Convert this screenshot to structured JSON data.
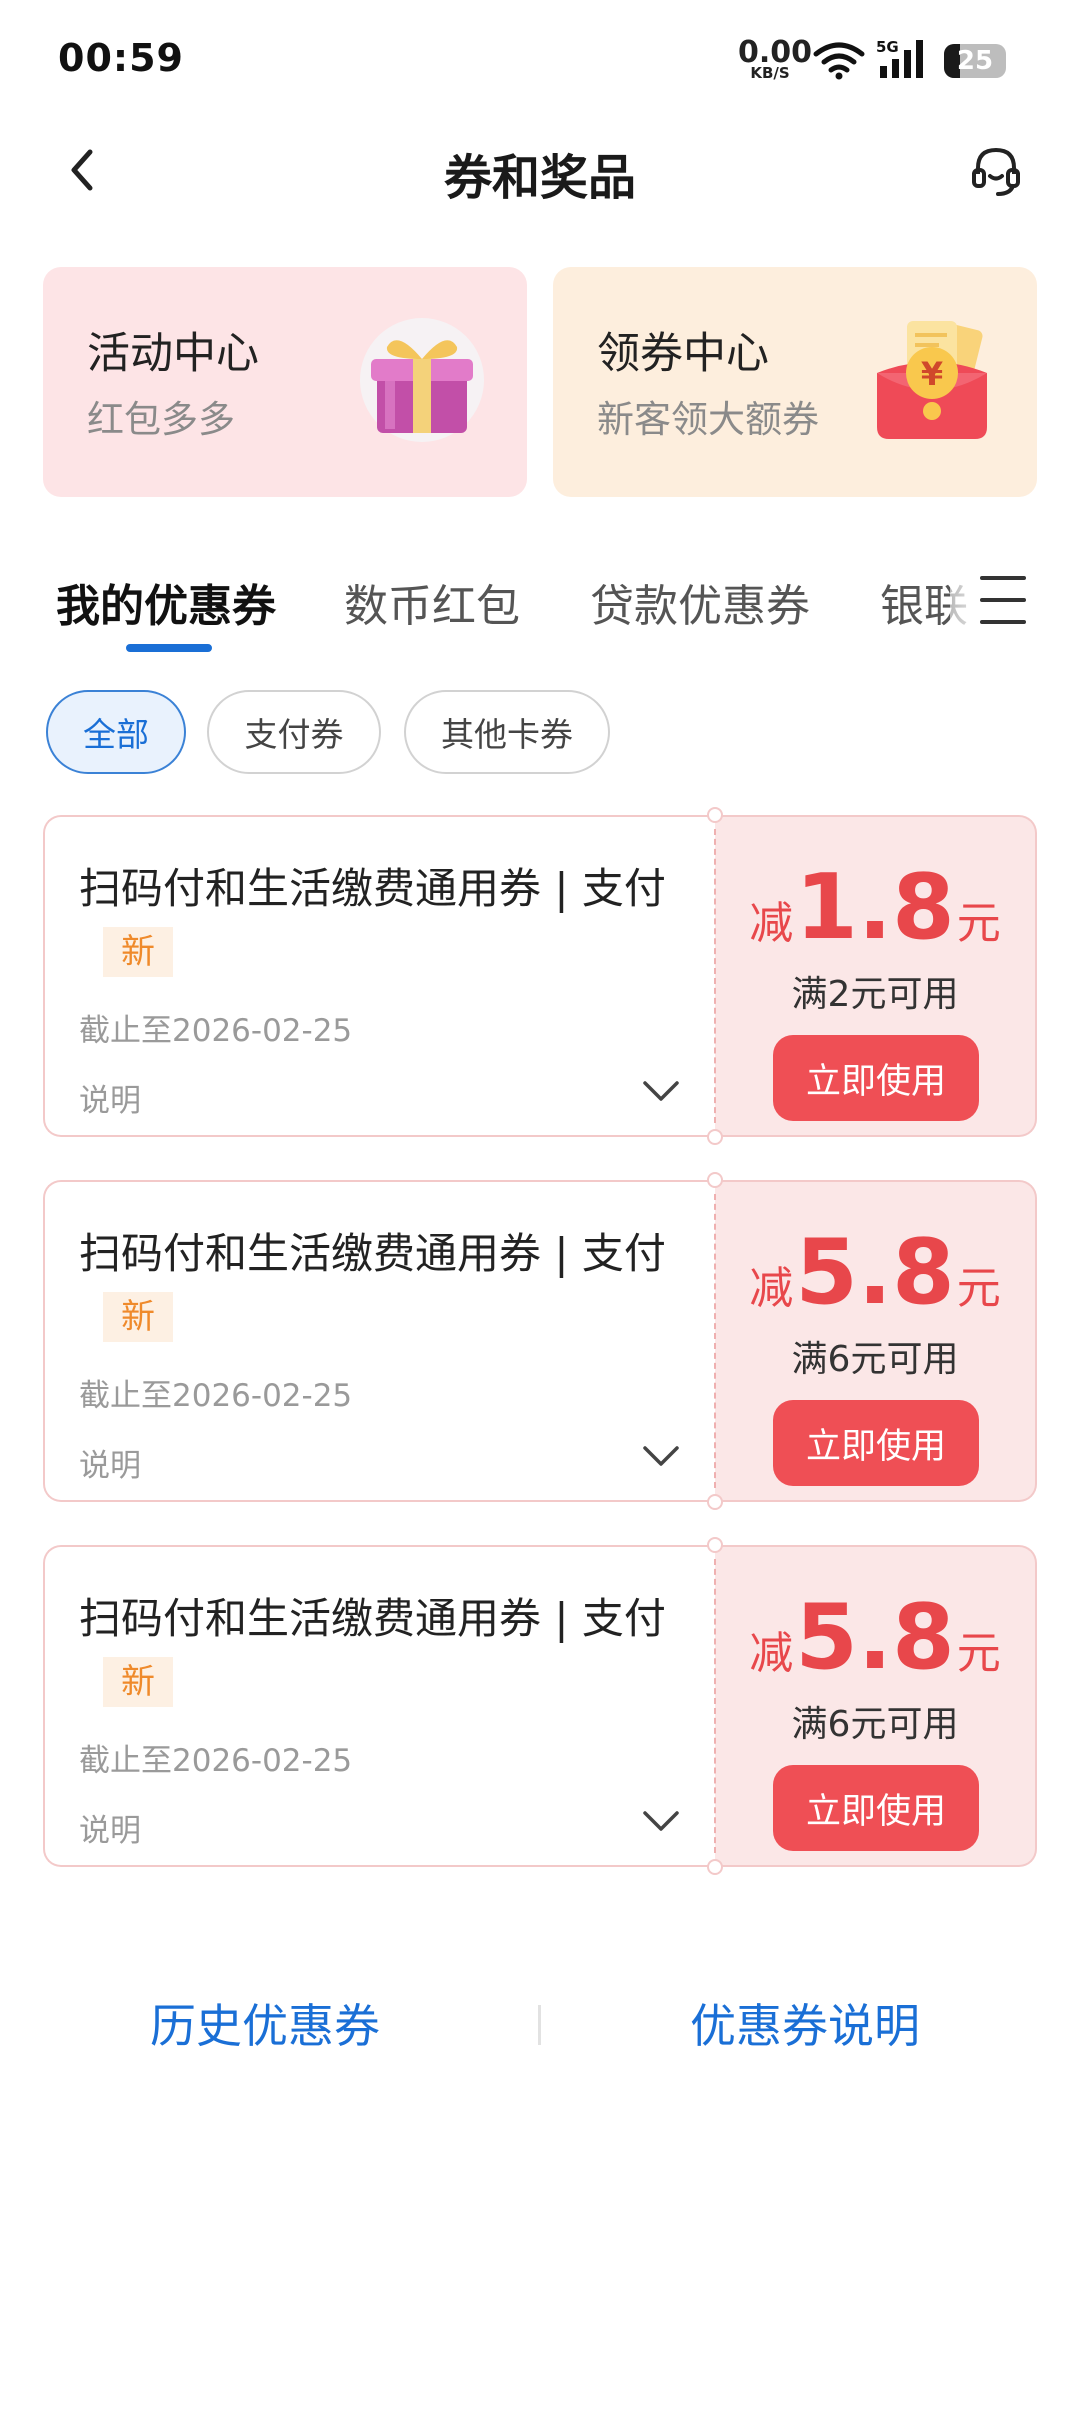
{
  "status_bar": {
    "time": "00:59",
    "net_speed": "0.00",
    "net_unit": "KB/S",
    "network": "5G",
    "battery": "25",
    "battery_level": 0.25
  },
  "header": {
    "title": "券和奖品",
    "back_icon": "chevron-left",
    "service_icon": "headset"
  },
  "promo_cards": [
    {
      "title": "活动中心",
      "subtitle": "红包多多",
      "icon": "gift-box"
    },
    {
      "title": "领券中心",
      "subtitle": "新客领大额券",
      "icon": "red-envelope-yuan"
    }
  ],
  "tabs": [
    {
      "label": "我的优惠券",
      "active": true
    },
    {
      "label": "数币红包",
      "active": false
    },
    {
      "label": "贷款优惠券",
      "active": false
    },
    {
      "label": "银联",
      "active": false
    }
  ],
  "filters": [
    {
      "label": "全部",
      "active": true
    },
    {
      "label": "支付券",
      "active": false
    },
    {
      "label": "其他卡券",
      "active": false
    }
  ],
  "coupons": [
    {
      "title": "扫码付和生活缴费通用券 | 支付",
      "badge": "新",
      "expiry": "截止至2026-02-25",
      "desc_label": "说明",
      "prefix": "减",
      "amount": "1.8",
      "unit": "元",
      "condition": "满2元可用",
      "button": "立即使用"
    },
    {
      "title": "扫码付和生活缴费通用券 | 支付",
      "badge": "新",
      "expiry": "截止至2026-02-25",
      "desc_label": "说明",
      "prefix": "减",
      "amount": "5.8",
      "unit": "元",
      "condition": "满6元可用",
      "button": "立即使用"
    },
    {
      "title": "扫码付和生活缴费通用券 | 支付",
      "badge": "新",
      "expiry": "截止至2026-02-25",
      "desc_label": "说明",
      "prefix": "减",
      "amount": "5.8",
      "unit": "元",
      "condition": "满6元可用",
      "button": "立即使用"
    }
  ],
  "footer": {
    "history_link": "历史优惠券",
    "explain_link": "优惠券说明"
  },
  "colors": {
    "accent_blue": "#1a6fd6",
    "coupon_red": "#e8474b",
    "button_red": "#ef4f55",
    "badge_orange": "#ef8a2b"
  }
}
